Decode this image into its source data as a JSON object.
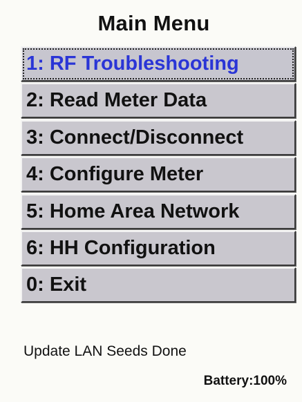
{
  "header": {
    "title": "Main Menu"
  },
  "menu": {
    "items": [
      {
        "label": "1: RF Troubleshooting",
        "selected": true
      },
      {
        "label": "2: Read Meter Data",
        "selected": false
      },
      {
        "label": "3: Connect/Disconnect",
        "selected": false
      },
      {
        "label": "4: Configure Meter",
        "selected": false
      },
      {
        "label": "5: Home Area Network",
        "selected": false
      },
      {
        "label": "6: HH Configuration",
        "selected": false
      },
      {
        "label": "0: Exit",
        "selected": false
      }
    ]
  },
  "status": {
    "message": "Update LAN Seeds Done",
    "battery": "Battery:100%"
  },
  "colors": {
    "selected_text": "#2a35d6",
    "button_face": "#c9c7ce",
    "background": "#fbfbf7"
  }
}
